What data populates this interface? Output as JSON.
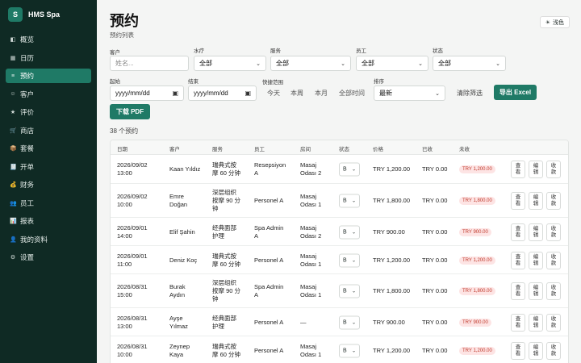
{
  "brand": {
    "logo": "S",
    "name": "HMS Spa"
  },
  "nav": [
    {
      "label": "概览",
      "icon": "◧",
      "active": false
    },
    {
      "label": "日历",
      "icon": "▦",
      "active": false
    },
    {
      "label": "预约",
      "icon": "≡",
      "active": true
    },
    {
      "label": "客户",
      "icon": "☺",
      "active": false
    },
    {
      "label": "评价",
      "icon": "★",
      "active": false
    },
    {
      "label": "商店",
      "icon": "🛒",
      "active": false
    },
    {
      "label": "套餐",
      "icon": "📦",
      "active": false
    },
    {
      "label": "开单",
      "icon": "🧾",
      "active": false
    },
    {
      "label": "财务",
      "icon": "💰",
      "active": false
    },
    {
      "label": "员工",
      "icon": "👥",
      "active": false
    },
    {
      "label": "报表",
      "icon": "📊",
      "active": false
    },
    {
      "label": "我的资料",
      "icon": "👤",
      "active": false
    },
    {
      "label": "设置",
      "icon": "⚙",
      "active": false
    }
  ],
  "page": {
    "title": "预约",
    "subtitle": "预约列表",
    "theme_icon": "☀",
    "theme_label": "浅色"
  },
  "filters": {
    "customer_label": "客户",
    "customer_placeholder": "姓名...",
    "spa_label": "水疗",
    "spa_value": "全部",
    "service_label": "服务",
    "service_value": "全部",
    "staff_label": "员工",
    "staff_value": "全部",
    "status_label": "状态",
    "status_value": "全部",
    "start_label": "起始",
    "start_placeholder": "yyyy/mm/dd",
    "end_label": "结束",
    "end_placeholder": "yyyy/mm/dd",
    "quick_label": "快捷范围",
    "quick_options": [
      "今天",
      "本周",
      "本月",
      "全部时间"
    ],
    "sort_label": "排序",
    "sort_value": "最新",
    "clear_label": "清除筛选",
    "export_excel": "导出 Excel",
    "download_pdf": "下载 PDF"
  },
  "summary": {
    "count_text": "38 个预约"
  },
  "table": {
    "columns": [
      "日期",
      "客户",
      "服务",
      "员工",
      "房间",
      "状态",
      "价格",
      "已收",
      "未收"
    ],
    "actions": [
      "查看",
      "编辑",
      "收款"
    ],
    "rows": [
      {
        "date": [
          "2026/09/02",
          "13:00"
        ],
        "customer": [
          "Kaan Yıldız"
        ],
        "service": [
          "瑞典式按",
          "摩 60 分钟"
        ],
        "staff": [
          "Resepsiyon",
          "A"
        ],
        "room": [
          "Masaj",
          "Odası 2"
        ],
        "status": "B",
        "price": "TRY 1,200.00",
        "paid": "TRY 0.00",
        "due": "TRY 1,200.00"
      },
      {
        "date": [
          "2026/09/02",
          "10:00"
        ],
        "customer": [
          "Emre",
          "Doğan"
        ],
        "service": [
          "深层组织",
          "按摩 90 分",
          "钟"
        ],
        "staff": [
          "Personel A"
        ],
        "room": [
          "Masaj",
          "Odası 1"
        ],
        "status": "B",
        "price": "TRY 1,800.00",
        "paid": "TRY 0.00",
        "due": "TRY 1,800.00"
      },
      {
        "date": [
          "2026/09/01",
          "14:00"
        ],
        "customer": [
          "Elif Şahin"
        ],
        "service": [
          "经典面部",
          "护理"
        ],
        "staff": [
          "Spa Admin",
          "A"
        ],
        "room": [
          "Masaj",
          "Odası 2"
        ],
        "status": "B",
        "price": "TRY 900.00",
        "paid": "TRY 0.00",
        "due": "TRY 900.00"
      },
      {
        "date": [
          "2026/09/01",
          "11:00"
        ],
        "customer": [
          "Deniz Koç"
        ],
        "service": [
          "瑞典式按",
          "摩 60 分钟"
        ],
        "staff": [
          "Personel A"
        ],
        "room": [
          "Masaj",
          "Odası 1"
        ],
        "status": "B",
        "price": "TRY 1,200.00",
        "paid": "TRY 0.00",
        "due": "TRY 1,200.00"
      },
      {
        "date": [
          "2026/08/31",
          "15:00"
        ],
        "customer": [
          "Burak",
          "Aydın"
        ],
        "service": [
          "深层组织",
          "按摩 90 分",
          "钟"
        ],
        "staff": [
          "Spa Admin",
          "A"
        ],
        "room": [
          "Masaj",
          "Odası 1"
        ],
        "status": "B",
        "price": "TRY 1,800.00",
        "paid": "TRY 0.00",
        "due": "TRY 1,800.00"
      },
      {
        "date": [
          "2026/08/31",
          "13:00"
        ],
        "customer": [
          "Ayşe",
          "Yılmaz"
        ],
        "service": [
          "经典面部",
          "护理"
        ],
        "staff": [
          "Personel A"
        ],
        "room": [
          "—"
        ],
        "status": "B",
        "price": "TRY 900.00",
        "paid": "TRY 0.00",
        "due": "TRY 900.00"
      },
      {
        "date": [
          "2026/08/31",
          "10:00"
        ],
        "customer": [
          "Zeynep",
          "Kaya"
        ],
        "service": [
          "瑞典式按",
          "摩 60 分钟"
        ],
        "staff": [
          "Personel A"
        ],
        "room": [
          "Masaj",
          "Odası 1"
        ],
        "status": "B",
        "price": "TRY 1,200.00",
        "paid": "TRY 0.00",
        "due": "TRY 1,200.00"
      }
    ]
  }
}
